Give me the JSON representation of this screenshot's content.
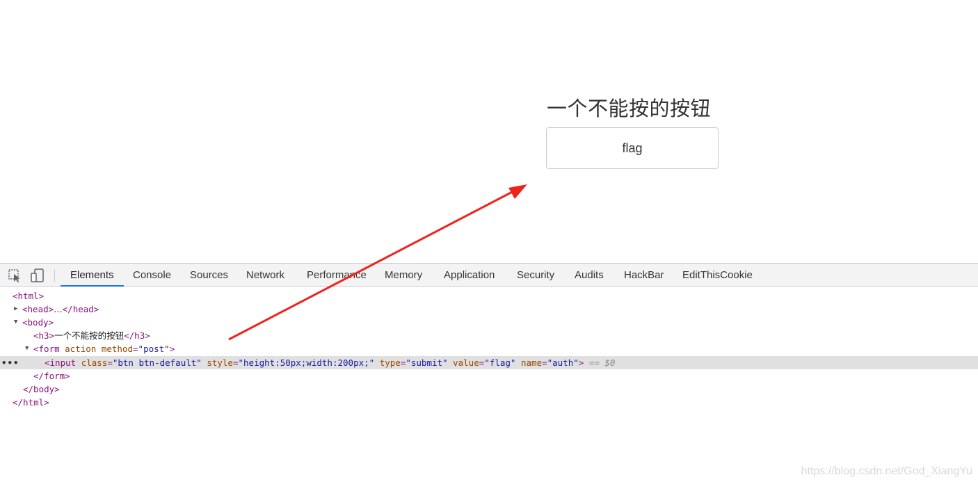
{
  "page": {
    "heading": "一个不能按的按钮",
    "button_value": "flag"
  },
  "devtools": {
    "tabs": [
      "Elements",
      "Console",
      "Sources",
      "Network",
      "Performance",
      "Memory",
      "Application",
      "Security",
      "Audits",
      "HackBar",
      "EditThisCookie"
    ],
    "active_tab": "Elements",
    "icons": [
      "inspect-element-icon",
      "device-toolbar-icon"
    ],
    "dom": {
      "html_open": "<html>",
      "head_open": "<head>",
      "head_ellipsis": "…",
      "head_close": "</head>",
      "body_open": "<body>",
      "h3_open": "<h3>",
      "h3_text": "一个不能按的按钮",
      "h3_close": "</h3>",
      "form_open_start": "<form",
      "form_attr1": "action",
      "form_attr2": "method",
      "form_attr2_eq": "=",
      "form_attr2_val": "\"post\"",
      "form_open_end": ">",
      "input_start": "<input",
      "input_class_name": "class",
      "input_class_val": "\"btn btn-default\"",
      "input_style_name": "style",
      "input_style_val": "\"height:50px;width:200px;\"",
      "input_type_name": "type",
      "input_type_val": "\"submit\"",
      "input_value_name": "value",
      "input_value_val": "\"flag\"",
      "input_name_name": "name",
      "input_name_val": "\"auth\"",
      "input_end": ">",
      "selected_marker_eq": "== ",
      "selected_marker_var": "$0",
      "row_ellipsis": "•••",
      "form_close": "</form>",
      "body_close": "</body>",
      "html_close": "</html>"
    }
  },
  "annotation": {
    "arrow_color": "#f0231b"
  },
  "watermark": "https://blog.csdn.net/God_XiangYu"
}
